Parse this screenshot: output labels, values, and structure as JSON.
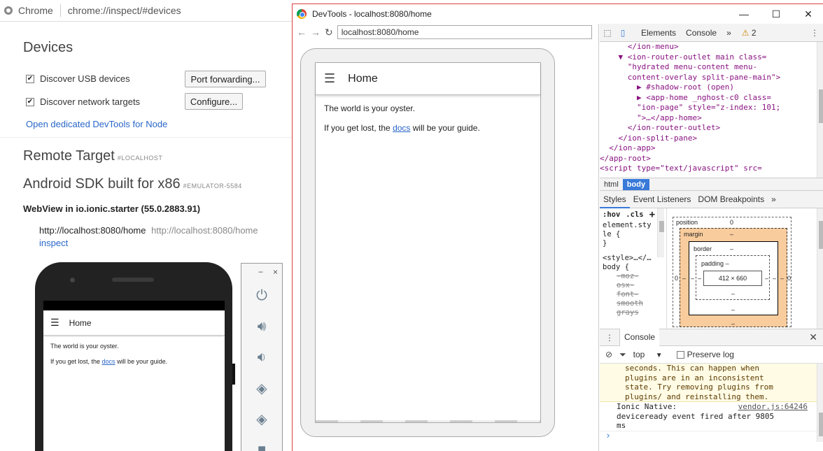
{
  "chrome": {
    "app_name": "Chrome",
    "url": "chrome://inspect/#devices"
  },
  "inspect": {
    "devices_title": "Devices",
    "discover_usb_label": "Discover USB devices",
    "discover_network_label": "Discover network targets",
    "port_forwarding_button": "Port forwarding...",
    "configure_button": "Configure...",
    "open_node_devtools_link": "Open dedicated DevTools for Node",
    "remote_target_title": "Remote Target",
    "remote_target_tag": "#LOCALHOST",
    "device_title": "Android SDK built for x86",
    "device_tag": "#EMULATOR-5584",
    "webview_title": "WebView in io.ionic.starter (55.0.2883.91)",
    "target_title": "http://localhost:8080/home",
    "target_url": "http://localhost:8080/home",
    "inspect_link": "inspect"
  },
  "app_preview": {
    "header_title": "Home",
    "line1": "The world is your oyster.",
    "line2_prefix": "If you get lost, the ",
    "line2_link": "docs",
    "line2_suffix": " will be your guide."
  },
  "emulator_controls": {
    "minimize": "−",
    "close": "×",
    "icons": [
      "power-icon",
      "volume-up-icon",
      "volume-down-icon",
      "rotate-left-icon",
      "rotate-right-icon",
      "camera-icon"
    ]
  },
  "devtools": {
    "window_title": "DevTools - localhost:8080/home",
    "screencast_url": "localhost:8080/home",
    "tabs": [
      "Elements",
      "Console"
    ],
    "warning_count": "2",
    "elements_lines": [
      {
        "indent": "      ",
        "html": "</ion-menu>"
      },
      {
        "indent": "    ▼ ",
        "html": "<ion-router-outlet main class="
      },
      {
        "indent": "      ",
        "html": "\"hydrated menu-content menu-"
      },
      {
        "indent": "      ",
        "html": "content-overlay split-pane-main\">"
      },
      {
        "indent": "        ▶ ",
        "html": "#shadow-root (open)"
      },
      {
        "indent": "        ▶ ",
        "html": "<app-home _nghost-c0 class="
      },
      {
        "indent": "        ",
        "html": "\"ion-page\" style=\"z-index: 101;"
      },
      {
        "indent": "        ",
        "html": "\">…</app-home>"
      },
      {
        "indent": "      ",
        "html": "</ion-router-outlet>"
      },
      {
        "indent": "    ",
        "html": "</ion-split-pane>"
      },
      {
        "indent": "  ",
        "html": "</ion-app>"
      },
      {
        "indent": "",
        "html": "</app-root>"
      },
      {
        "indent": "",
        "html": "<script type=\"text/javascript\" src="
      }
    ],
    "breadcrumbs": [
      "html",
      "body"
    ],
    "styles_tabs": [
      "Styles",
      "Event Listeners",
      "DOM Breakpoints"
    ],
    "hov_label": ":hov",
    "cls_label": ".cls",
    "styles_rules": [
      "element.sty",
      "le {",
      "}",
      "<style>…</…",
      "body {"
    ],
    "styles_struck": [
      "-moz-",
      "osx-",
      "font-",
      "smooth",
      "grays"
    ],
    "box_model": {
      "position_label": "position",
      "position_value": "0",
      "margin_label": "margin",
      "margin_value": "–",
      "border_label": "border",
      "border_value": "–",
      "padding_label": "padding",
      "padding_value": "–",
      "content_size": "412 × 660",
      "side_value": "0",
      "dash": "–"
    },
    "console": {
      "tab_label": "Console",
      "context": "top",
      "preserve_log_label": "Preserve log",
      "warning_lines": [
        "seconds. This can happen when",
        "plugins are in an inconsistent",
        "state. Try removing plugins from",
        "plugins/ and reinstalling them."
      ],
      "message_prefix": "Ionic Native:",
      "message_source": "vendor.js:64246",
      "message_lines": [
        "deviceready event fired after 9805",
        "ms"
      ],
      "prompt": "›"
    }
  }
}
